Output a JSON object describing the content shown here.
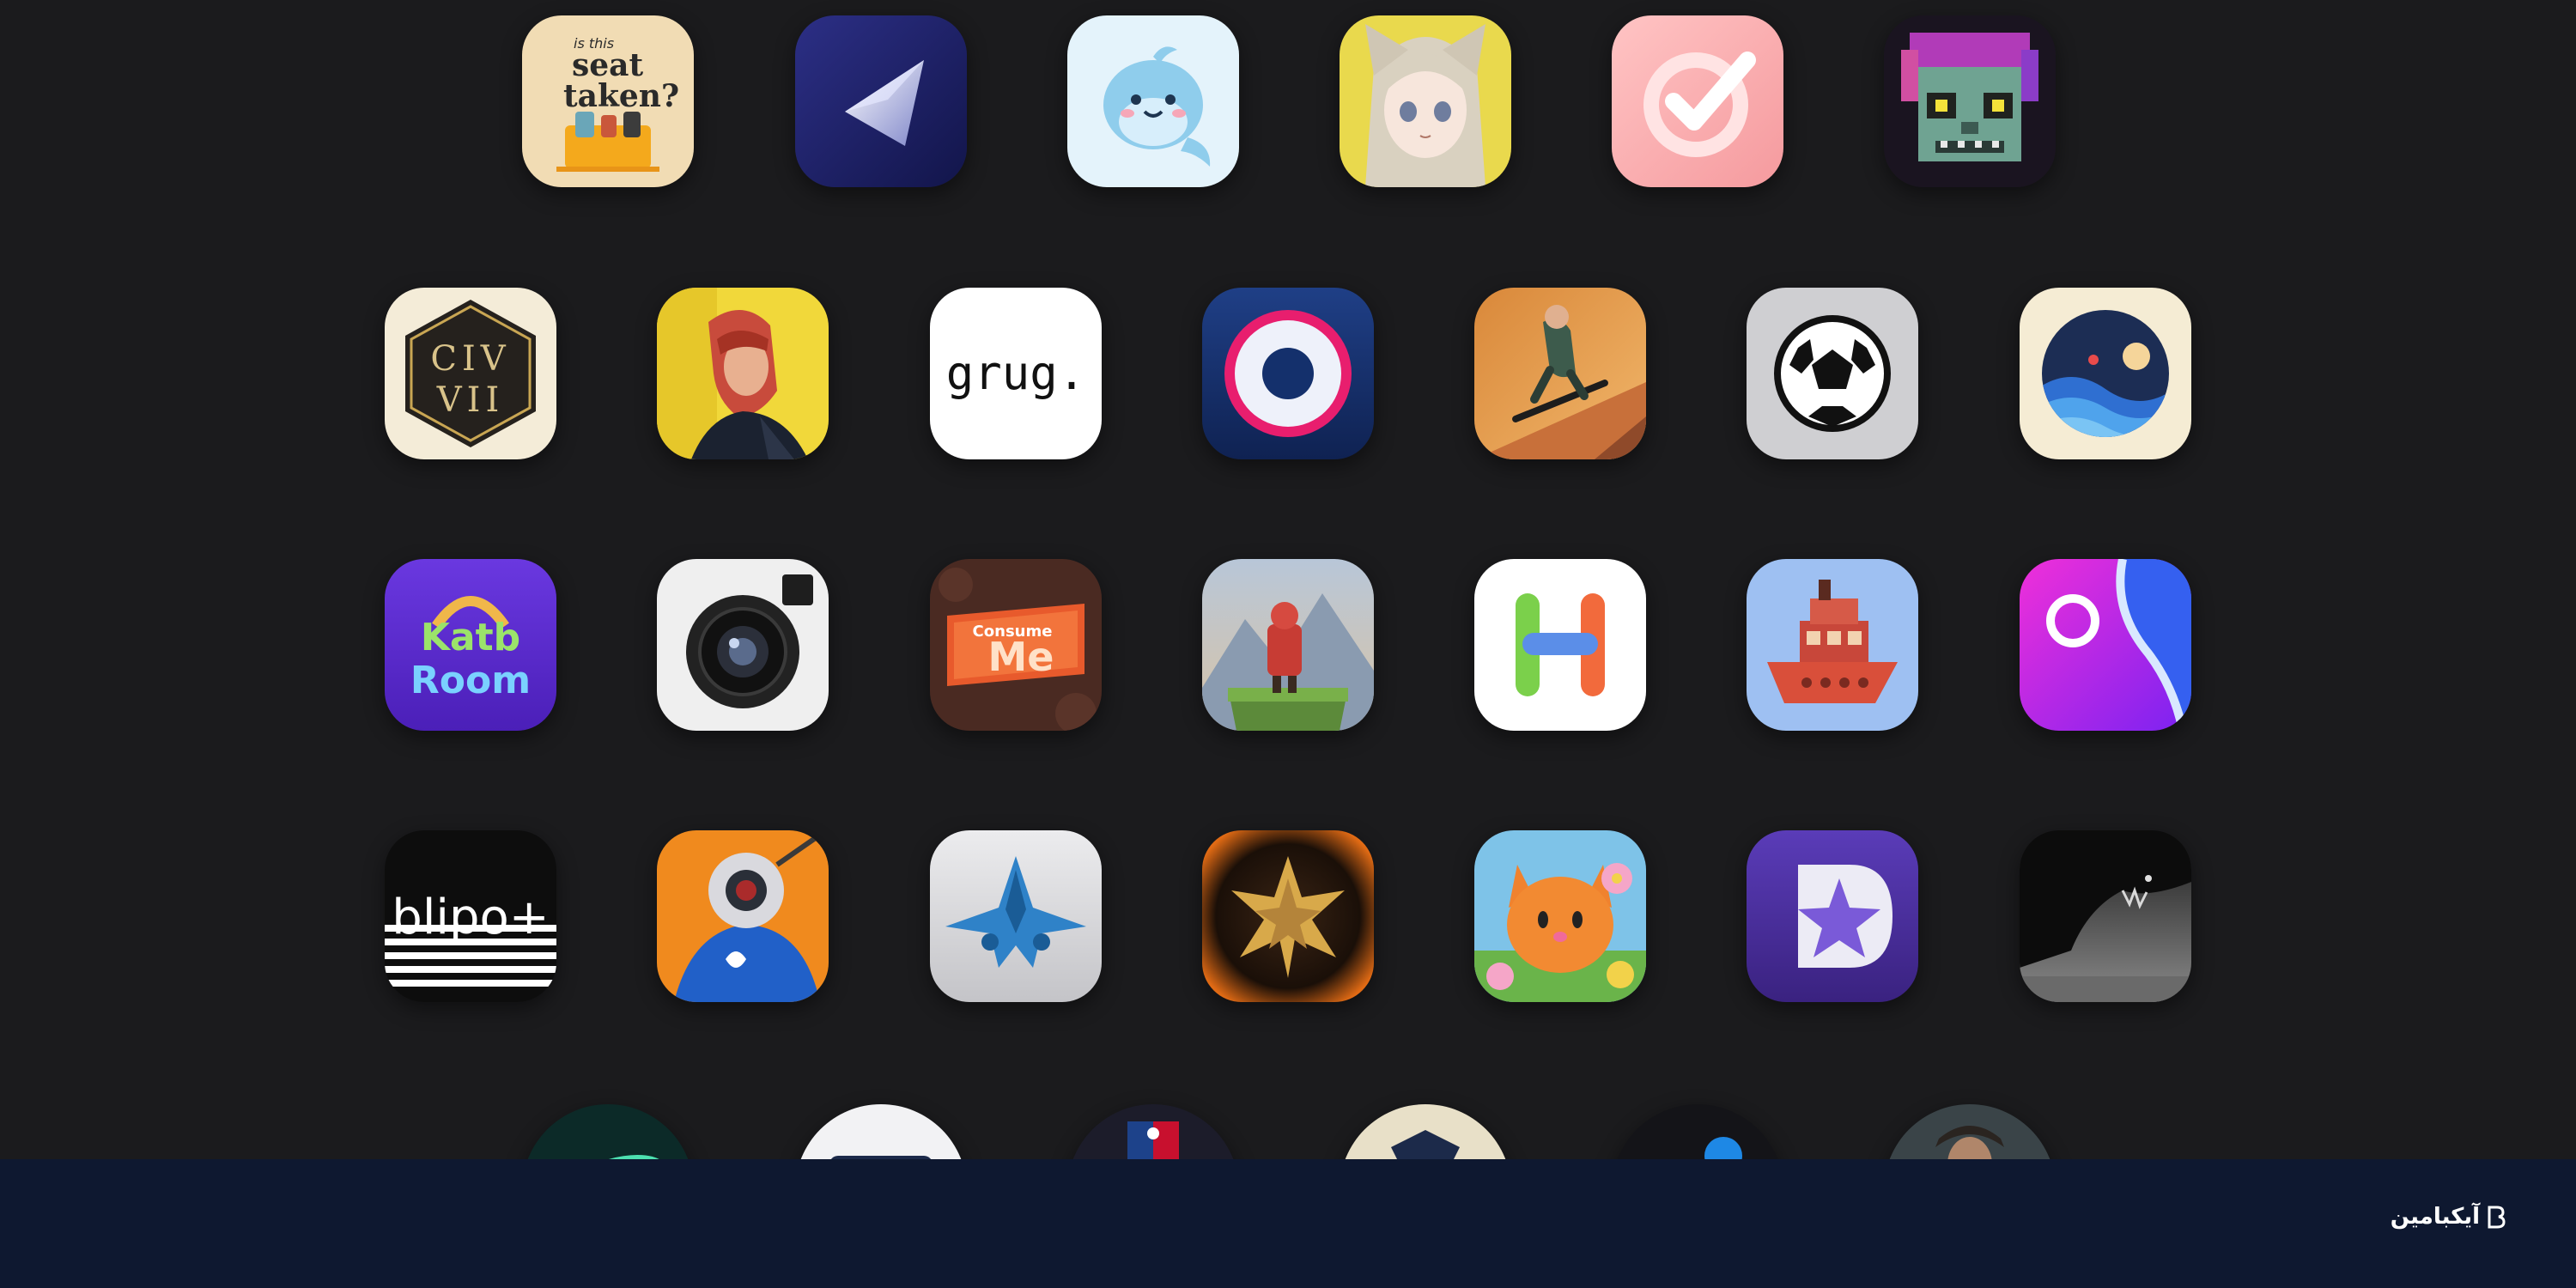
{
  "footer": {
    "brand_name": "آیکبامین",
    "brand_mark": "ikb-logo-icon"
  },
  "icon_texts": {
    "seat_small": "is this",
    "seat_big1": "seat",
    "seat_big2": "taken?",
    "civ1": "CIV",
    "civ2": "VII",
    "grug": "grug.",
    "katb1": "Katb",
    "katb2": "Room",
    "consume1": "Consume",
    "consume2": "Me",
    "blip": "blipo+"
  },
  "colors": {
    "page_background": "#1b1b1d",
    "footer_background": "#0e1830",
    "footer_text": "#ffffff"
  }
}
